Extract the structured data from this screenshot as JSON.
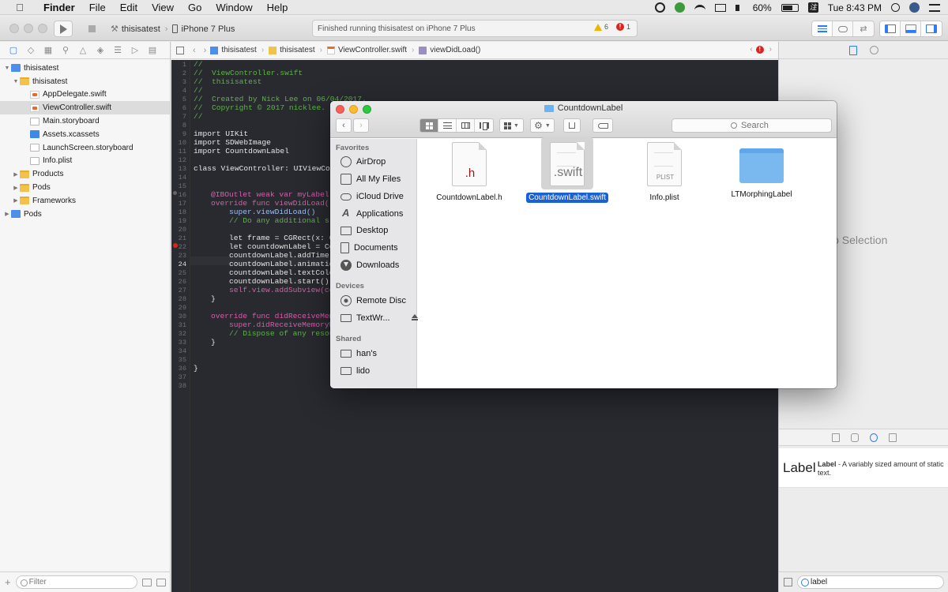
{
  "menubar": {
    "app_name": "Finder",
    "menus": [
      "File",
      "Edit",
      "View",
      "Go",
      "Window",
      "Help"
    ],
    "battery": "60%",
    "clock": "Tue 8:43 PM"
  },
  "xcode": {
    "scheme": "thisisatest",
    "device": "iPhone 7 Plus",
    "status": "Finished running thisisatest on iPhone 7 Plus",
    "warnings": "6",
    "errors": "1",
    "jumpbar": [
      "thisisatest",
      "thisisatest",
      "ViewController.swift",
      "viewDidLoad()"
    ]
  },
  "navigator": {
    "items": [
      {
        "label": "thisisatest",
        "type": "project"
      },
      {
        "label": "thisisatest",
        "type": "folder"
      },
      {
        "label": "AppDelegate.swift",
        "type": "swift"
      },
      {
        "label": "ViewController.swift",
        "type": "swift"
      },
      {
        "label": "Main.storyboard",
        "type": "storyboard"
      },
      {
        "label": "Assets.xcassets",
        "type": "assets"
      },
      {
        "label": "LaunchScreen.storyboard",
        "type": "storyboard"
      },
      {
        "label": "Info.plist",
        "type": "plist"
      },
      {
        "label": "Products",
        "type": "folder"
      },
      {
        "label": "Pods",
        "type": "folder"
      },
      {
        "label": "Frameworks",
        "type": "folder"
      },
      {
        "label": "Pods",
        "type": "project"
      }
    ],
    "filter_placeholder": "Filter"
  },
  "editor": {
    "line_numbers": [
      "1",
      "2",
      "3",
      "4",
      "5",
      "6",
      "7",
      "8",
      "9",
      "10",
      "11",
      "12",
      "13",
      "14",
      "15",
      "16",
      "17",
      "18",
      "19",
      "20",
      "21",
      "22",
      "23",
      "24",
      "25",
      "26",
      "27",
      "28",
      "29",
      "30",
      "31",
      "32",
      "33",
      "34",
      "35",
      "36",
      "37",
      "38"
    ],
    "lines": [
      "//",
      "//  ViewController.swift",
      "//  thisisatest",
      "//",
      "//  Created by Nick Lee on 06/04/2017.",
      "//  Copyright © 2017 nicklee.",
      "//",
      "import UIKit",
      "import SDWebImage",
      "import CountdownLabel",
      "class ViewController: UIViewCon",
      "@IBOutlet weak var myLabel:",
      "override func viewDidLoad()",
      "super.viewDidLoad()",
      "// Do any additional s",
      "let frame = CGRect(x: 0",
      "let countdownLabel = Co",
      "countdownLabel.addTime",
      "countdownLabel.animatio",
      "countdownLabel.textColo",
      "countdownLabel.start()",
      "self.view.addSubview(co",
      "}",
      "override func didReceiveMem",
      "super.didReceiveMemoryW",
      "// Dispose of any resou",
      "}",
      "}"
    ]
  },
  "utility": {
    "no_selection": "No Selection",
    "library_item_title": "Label",
    "library_item_name": "Label",
    "library_item_desc": " - A variably sized amount of static text.",
    "library_filter": "label"
  },
  "finder": {
    "title": "CountdownLabel",
    "search_placeholder": "Search",
    "sidebar": {
      "favorites_header": "Favorites",
      "favorites": [
        "AirDrop",
        "All My Files",
        "iCloud Drive",
        "Applications",
        "Desktop",
        "Documents",
        "Downloads"
      ],
      "devices_header": "Devices",
      "devices": [
        "Remote Disc",
        "TextWr..."
      ],
      "shared_header": "Shared",
      "shared": [
        "han's",
        "lido"
      ]
    },
    "files": [
      {
        "name": "CountdownLabel.h",
        "ext": ".h",
        "selected": false
      },
      {
        "name": "CountdownLabel.swift",
        "ext": ".swift",
        "selected": true
      },
      {
        "name": "Info.plist",
        "ext": "PLIST",
        "selected": false
      },
      {
        "name": "LTMorphingLabel",
        "ext": "",
        "selected": false
      }
    ]
  }
}
